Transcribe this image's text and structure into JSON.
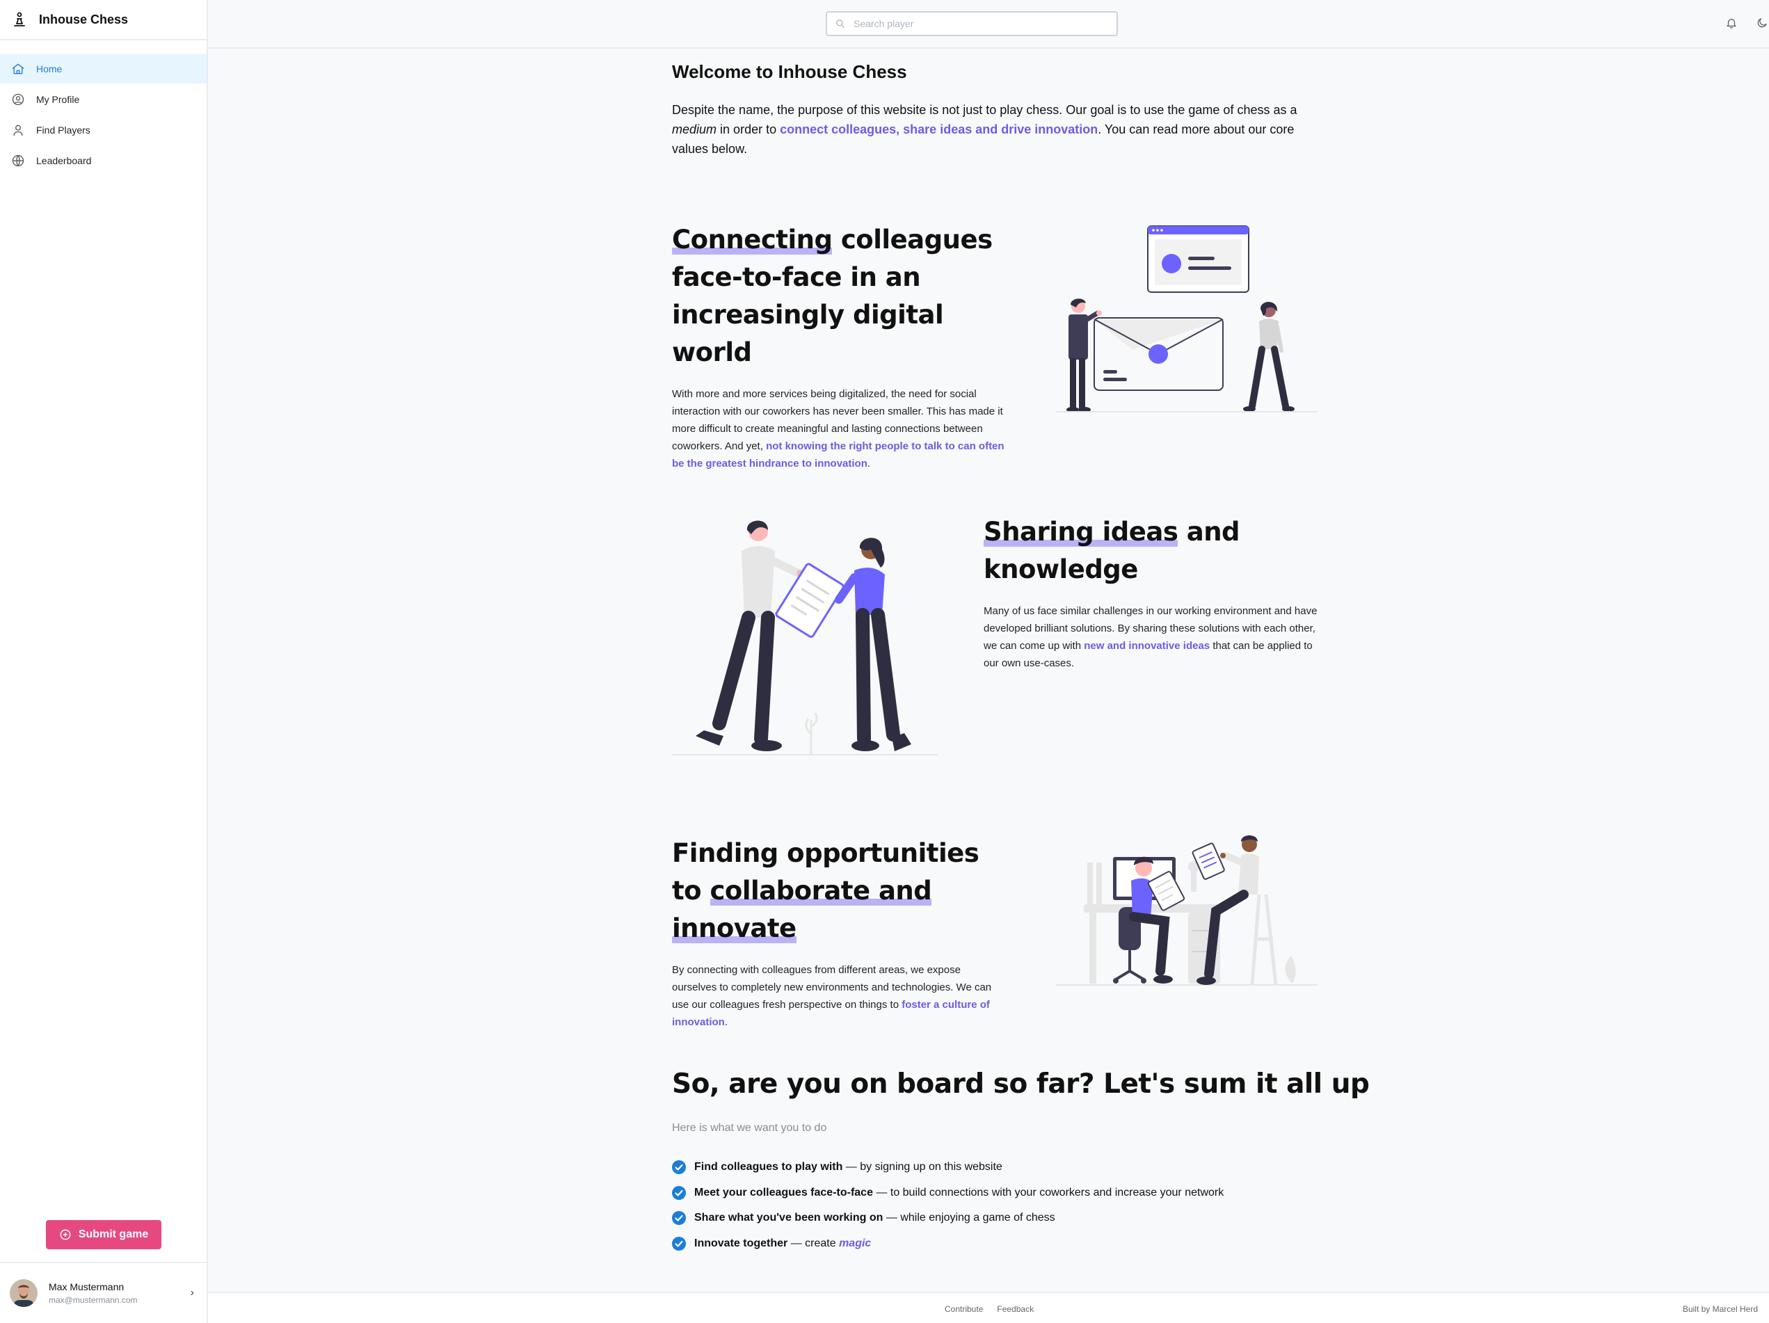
{
  "app": {
    "title": "Inhouse Chess"
  },
  "sidebar": {
    "items": [
      {
        "label": "Home",
        "icon": "home-icon",
        "active": true
      },
      {
        "label": "My Profile",
        "icon": "user-circle-icon"
      },
      {
        "label": "Find Players",
        "icon": "user-icon"
      },
      {
        "label": "Leaderboard",
        "icon": "globe-icon"
      }
    ],
    "submit_label": "Submit game",
    "user": {
      "name": "Max Mustermann",
      "email": "max@mustermann.com"
    }
  },
  "header": {
    "search_placeholder": "Search player"
  },
  "welcome": {
    "title": "Welcome to Inhouse Chess",
    "intro_1": "Despite the name, the purpose of this website is not just to play chess. Our goal is to use the game of chess as a",
    "intro_em": "medium",
    "intro_2": "in order to",
    "intro_link": "connect colleagues, share ideas and drive innovation",
    "intro_3": ". You can read more about our core values below."
  },
  "sections": {
    "connect": {
      "title_hl": "Connecting",
      "title_rest": "colleagues face-to-face in an increasingly digital world",
      "text": "With more and more services being digitalized, the need for social interaction with our coworkers has never been smaller. This has made it more difficult to create meaningful and lasting connections between coworkers. And yet,",
      "link": "not knowing the right people to talk to can often be the greatest hindrance to innovation",
      "after": "."
    },
    "share": {
      "title_hl": "Sharing ideas",
      "title_rest": "and knowledge",
      "text": "Many of us face similar challenges in our working environment and have developed brilliant solutions. By sharing these solutions with each other, we can come up with",
      "link": "new and innovative ideas",
      "after": "that can be applied to our own use-cases."
    },
    "find": {
      "title_plain": "Finding opportunities to",
      "title_hl": "collaborate and innovate",
      "text": "By connecting with colleagues from different areas, we expose ourselves to completely new environments and technologies. We can use our colleagues fresh perspective on things to",
      "link": "foster a culture of innovation",
      "after": "."
    }
  },
  "summary": {
    "title": "So, are you on board so far? Let's sum it all up",
    "subtitle": "Here is what we want you to do",
    "items": [
      {
        "bold": "Find colleagues to play with",
        "rest": "— by signing up on this website"
      },
      {
        "bold": "Meet your colleagues face-to-face",
        "rest": "— to build connections with your coworkers and increase your network"
      },
      {
        "bold": "Share what you've been working on",
        "rest": "— while enjoying a game of chess"
      },
      {
        "bold": "Innovate together",
        "rest": "— create",
        "em": "magic"
      }
    ]
  },
  "footer": {
    "links": [
      "Contribute",
      "Feedback"
    ],
    "credit": "Built by Marcel Herd"
  },
  "colors": {
    "accent": "#6c5ce7",
    "primary": "#1c7ed6",
    "submit": "#e64980",
    "illustration_purple": "#6c63ff"
  }
}
